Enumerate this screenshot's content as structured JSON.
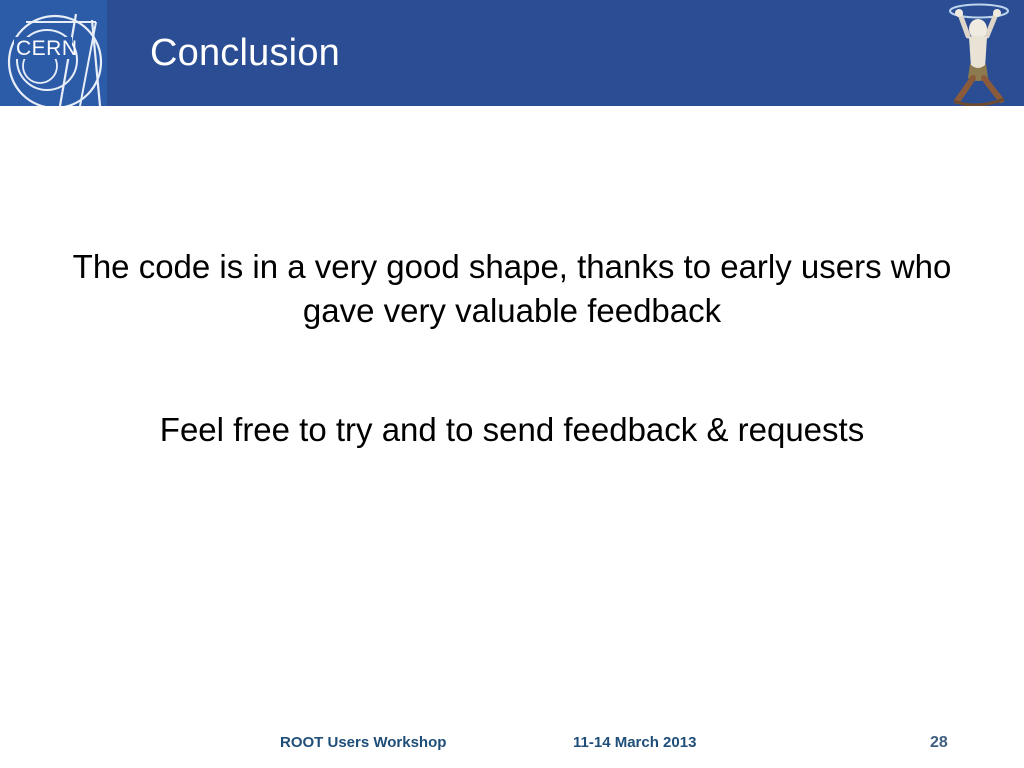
{
  "slide": {
    "title": "Conclusion",
    "brand_logo_text": "CERN",
    "logo_icon_name": "cern-logo",
    "figure_icon_name": "dancing-figure-icon",
    "colors": {
      "banner": "#2a4d93",
      "logo_panel": "#2c5ba8",
      "title_text": "#ffffff",
      "body_text": "#000000",
      "footer_text": "#1f4e79",
      "page_number_text": "#3f5f80",
      "background": "#ffffff"
    },
    "body": {
      "blocks": [
        "The code is in a very good shape, thanks to early users who gave very valuable feedback",
        "Feel free to try and to send feedback & requests"
      ]
    },
    "footer": {
      "event": "ROOT Users Workshop",
      "date": "11-14 March 2013",
      "page_number": "28"
    }
  }
}
